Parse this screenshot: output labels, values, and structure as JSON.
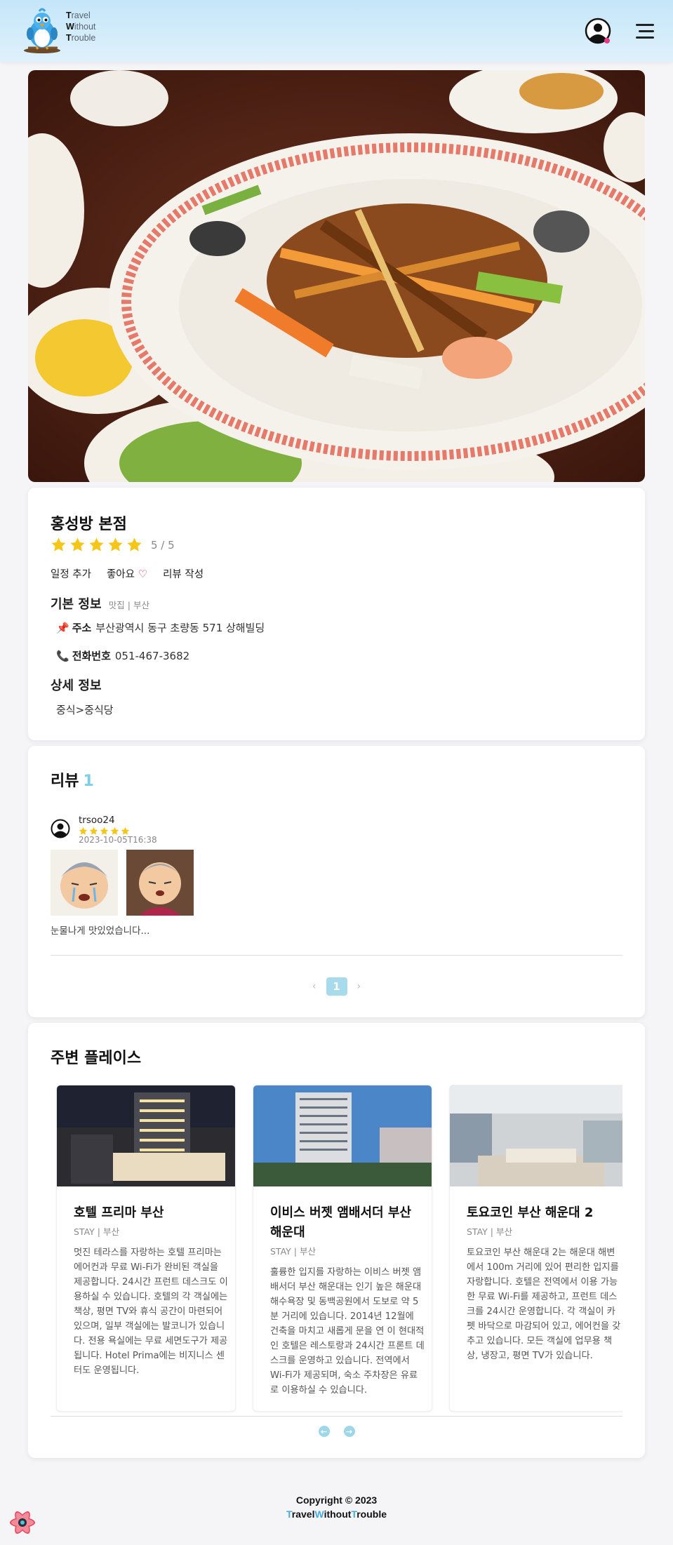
{
  "header": {
    "logo_lines": [
      "ravel",
      "ithout",
      "rouble"
    ],
    "logo_initials": [
      "T",
      "W",
      "T"
    ]
  },
  "place": {
    "name": "홍성방 본점",
    "rating": 5,
    "rating_text": "5 / 5",
    "actions": {
      "schedule": "일정 추가",
      "like": "좋아요",
      "like_icon": "♡",
      "review": "리뷰 작성"
    },
    "basic_info": {
      "title": "기본 정보",
      "sub": "맛집 | 부산",
      "address_icon": "📌",
      "address_label": "주소",
      "address": "부산광역시 동구 초량동 571 상해빌딩",
      "phone_icon": "📞",
      "phone_label": "전화번호",
      "phone": "051-467-3682"
    },
    "detail_info": {
      "title": "상세 정보",
      "category": "중식>중식당"
    }
  },
  "reviews": {
    "title": "리뷰",
    "count": "1",
    "items": [
      {
        "user": "trsoo24",
        "stars": 5,
        "date": "2023-10-05T16:38",
        "text": "눈물나게 맛있었습니다..."
      }
    ],
    "pager": {
      "prev": "‹",
      "current": "1",
      "next": "›"
    }
  },
  "nearby": {
    "title": "주변 플레이스",
    "items": [
      {
        "name": "호텔 프리마 부산",
        "category": "STAY | 부산",
        "desc": "멋진 테라스를 자랑하는 호텔 프리마는 에어컨과 무료 Wi-Fi가 완비된 객실을 제공합니다. 24시간 프런트 데스크도 이용하실 수 있습니다. 호텔의 각 객실에는 책상, 평면 TV와 휴식 공간이 마련되어 있으며, 일부 객실에는 발코니가 있습니다. 전용 욕실에는 무료 세면도구가 제공됩니다. Hotel Prima에는 비지니스 센터도 운영됩니다."
      },
      {
        "name": "이비스 버젯 앰배서더 부산 해운대",
        "category": "STAY | 부산",
        "desc": "훌륭한 입지를 자랑하는 이비스 버젯 앰배서더 부산 해운대는 인기 높은 해운대해수욕장 및 동백공원에서 도보로 약 5분 거리에 있습니다. 2014년 12월에 건축을 마치고 새롭게 문을 연 이 현대적인 호텔은 레스토랑과 24시간 프론트 데스크를 운영하고 있습니다. 전역에서 Wi-Fi가 제공되며, 숙소 주차장은 유료로 이용하실 수 있습니다."
      },
      {
        "name": "토요코인 부산 해운대 2",
        "category": "STAY | 부산",
        "desc": "토요코인 부산 해운대 2는 해운대 해변에서 100m 거리에 있어 편리한 입지를 자랑합니다. 호텔은 전역에서 이용 가능한 무료 Wi-Fi를 제공하고, 프런트 데스크를 24시간 운영합니다. 각 객실이 카펫 바닥으로 마감되어 있고, 에어컨을 갖추고 있습니다. 모든 객실에 업무용 책상, 냉장고, 평면 TV가 있습니다."
      }
    ],
    "nav": {
      "prev": "←",
      "next": "→"
    }
  },
  "footer": {
    "copyright": "Copyright © 2023",
    "brand_parts": [
      "T",
      "ravel",
      "W",
      "ithout",
      "T",
      "rouble"
    ]
  },
  "colors": {
    "accent": "#7fcfe4",
    "star": "#f5c518",
    "heart": "#e0245e",
    "header_bg": "#c4e6f9"
  }
}
